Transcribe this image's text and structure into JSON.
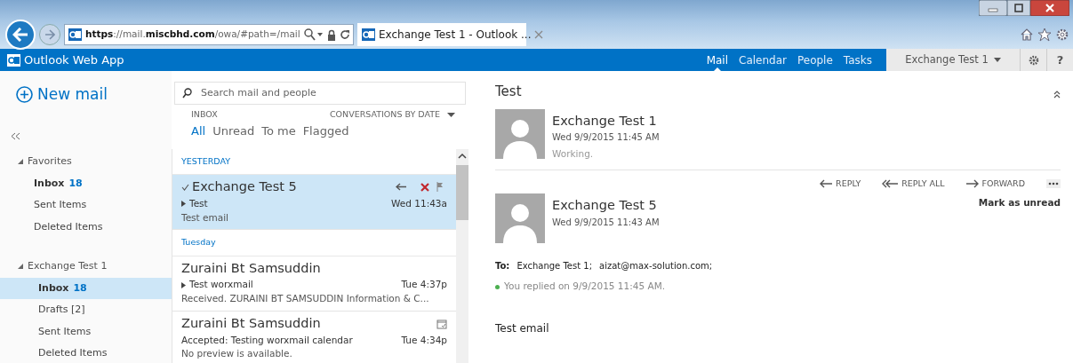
{
  "browser": {
    "url": "**https**://mail.**miscbhd.com**/owa/#path=/mail",
    "tab_title": "Exchange Test 1 - Outlook ..."
  },
  "app": {
    "title": "Outlook Web App",
    "nav": [
      {
        "label": "Mail",
        "selected": true
      },
      {
        "label": "Calendar",
        "selected": false
      },
      {
        "label": "People",
        "selected": false
      },
      {
        "label": "Tasks",
        "selected": false
      }
    ],
    "user": "Exchange Test 1",
    "help": "?"
  },
  "sidebar": {
    "new_mail": "New mail",
    "groups": [
      {
        "label": "Favorites",
        "expanded": true,
        "items": [
          {
            "label": "Inbox",
            "count": "18",
            "selected": false
          },
          {
            "label": "Sent Items",
            "selected": false
          },
          {
            "label": "Deleted Items",
            "selected": false
          }
        ]
      },
      {
        "label": "Exchange Test 1",
        "expanded": true,
        "items": [
          {
            "label": "Inbox",
            "count": "18",
            "selected": true
          },
          {
            "label": "Drafts [2]",
            "selected": false
          },
          {
            "label": "Sent Items",
            "selected": false
          },
          {
            "label": "Deleted Items",
            "selected": false
          }
        ]
      }
    ]
  },
  "message_list": {
    "search_placeholder": "Search mail and people",
    "folder": "INBOX",
    "sort": "CONVERSATIONS BY DATE",
    "filters": [
      {
        "label": "All",
        "selected": true
      },
      {
        "label": "Unread",
        "selected": false
      },
      {
        "label": "To me",
        "selected": false
      },
      {
        "label": "Flagged",
        "selected": false
      }
    ],
    "groups": [
      {
        "header": "YESTERDAY",
        "messages": [
          {
            "sender": "Exchange Test 5",
            "subject": "Test",
            "preview": "Test email",
            "time": "Wed 11:43a",
            "selected": true,
            "checked": true,
            "expandable": true
          }
        ]
      },
      {
        "header": "Tuesday",
        "messages": [
          {
            "sender": "Zuraini Bt Samsuddin",
            "subject": "Test worxmail",
            "preview": "Received. ZURAINI BT SAMSUDDIN Information & C...",
            "time": "Tue 4:37p",
            "selected": false,
            "checked": false,
            "expandable": true
          },
          {
            "sender": "Zuraini Bt Samsuddin",
            "subject": "Accepted: Testing worxmail calendar",
            "preview": "No preview is available.",
            "time": "Tue 4:34p",
            "selected": false,
            "checked": false,
            "expandable": false,
            "kind": "meeting"
          }
        ]
      }
    ]
  },
  "reading_pane": {
    "subject": "Test",
    "messages": [
      {
        "sender": "Exchange Test 1",
        "date": "Wed 9/9/2015 11:45 AM",
        "preview": "Working."
      },
      {
        "sender": "Exchange Test 5",
        "date": "Wed 9/9/2015 11:43 AM",
        "to_label": "To:",
        "recipients": [
          "Exchange Test 1;",
          "aizat@max-solution.com;"
        ],
        "status": "You replied on 9/9/2015 11:45 AM.",
        "body": "Test email"
      }
    ],
    "actions": [
      {
        "kind": "reply",
        "label": "REPLY"
      },
      {
        "kind": "reply_all",
        "label": "REPLY ALL"
      },
      {
        "kind": "forward",
        "label": "FORWARD"
      }
    ],
    "mark_unread": "Mark as unread"
  }
}
